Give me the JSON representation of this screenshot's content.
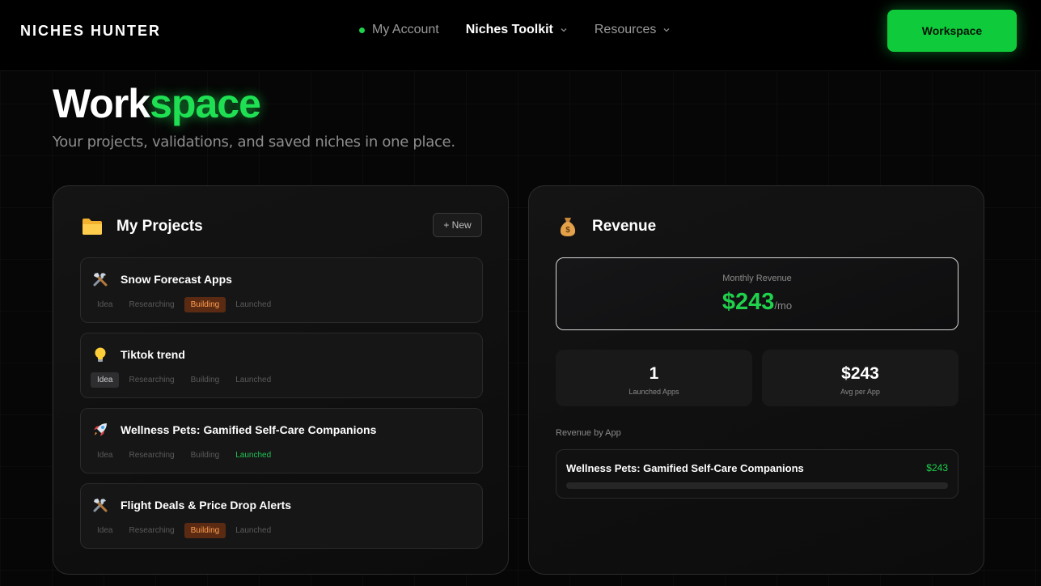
{
  "nav": {
    "brand": "NICHES HUNTER",
    "links": [
      {
        "label": "My Account"
      },
      {
        "label": "Niches Toolkit"
      },
      {
        "label": "Resources"
      }
    ],
    "cta_label": "Workspace"
  },
  "header": {
    "title_part1": "Work",
    "title_part2": "space",
    "subtitle": "Your projects, validations, and saved niches in one place."
  },
  "projects": {
    "title": "My Projects",
    "new_label": "+ New",
    "stage_labels": [
      "Idea",
      "Researching",
      "Building",
      "Launched"
    ],
    "items": [
      {
        "name": "Snow Forecast Apps",
        "icon": "tools-icon",
        "active_stage": "Building"
      },
      {
        "name": "Tiktok trend",
        "icon": "lightbulb-icon",
        "active_stage": "Idea"
      },
      {
        "name": "Wellness Pets: Gamified Self-Care Companions",
        "icon": "rocket-icon",
        "active_stage": "Launched"
      },
      {
        "name": "Flight Deals & Price Drop Alerts",
        "icon": "tools-icon",
        "active_stage": "Building"
      }
    ]
  },
  "revenue": {
    "title": "Revenue",
    "monthly_label": "Monthly Revenue",
    "monthly_amount": "$243",
    "monthly_suffix": "/mo",
    "stats": [
      {
        "value": "1",
        "label": "Launched Apps"
      },
      {
        "value": "$243",
        "label": "Avg per App"
      }
    ],
    "by_app_label": "Revenue by App",
    "by_app": [
      {
        "name": "Wellness Pets: Gamified Self-Care Companions",
        "value": "$243"
      }
    ]
  },
  "colors": {
    "accent": "#1fd14b",
    "building": "#ff9c50",
    "background": "#060606"
  }
}
